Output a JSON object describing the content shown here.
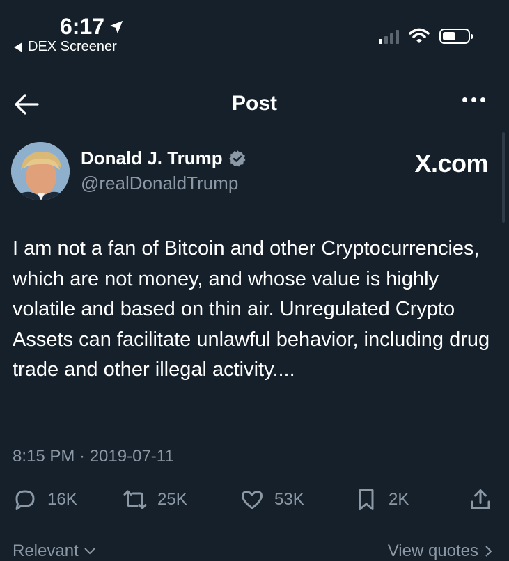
{
  "status_bar": {
    "time": "6:17",
    "back_app": "DEX Screener"
  },
  "header": {
    "title": "Post"
  },
  "author": {
    "name": "Donald J. Trump",
    "handle": "@realDonaldTrump"
  },
  "watermark": "X.com",
  "tweet": {
    "text": "I am not a fan of Bitcoin and other Cryptocurrencies, which are not money, and whose value is highly volatile and based on thin air. Unregulated Crypto Assets can facilitate unlawful behavior, including drug trade and other illegal activity....",
    "timestamp": "8:15 PM · 2019-07-11"
  },
  "actions": {
    "replies": "16K",
    "reposts": "25K",
    "likes": "53K",
    "bookmarks": "2K"
  },
  "footer": {
    "sort_label": "Relevant",
    "quotes_label": "View quotes"
  },
  "colors": {
    "background": "#15202b",
    "secondary_text": "#8b98a5",
    "verified": "#8b98a5"
  }
}
